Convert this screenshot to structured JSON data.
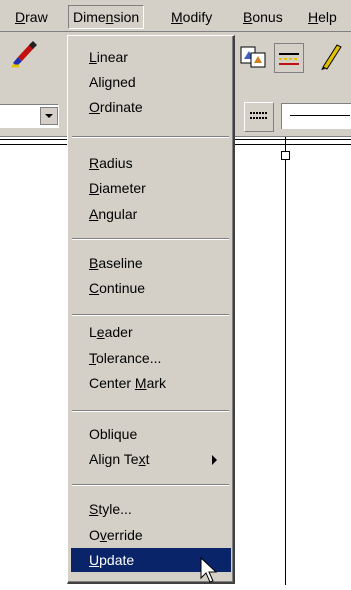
{
  "menubar": {
    "items": [
      {
        "prefix": "",
        "key": "D",
        "suffix": "raw"
      },
      {
        "prefix": "Dime",
        "key": "n",
        "suffix": "sion"
      },
      {
        "prefix": "",
        "key": "M",
        "suffix": "odify"
      },
      {
        "prefix": "",
        "key": "B",
        "suffix": "onus"
      },
      {
        "prefix": "",
        "key": "H",
        "suffix": "elp"
      }
    ]
  },
  "dimension_menu": {
    "items": [
      {
        "prefix": "",
        "key": "L",
        "suffix": "inear"
      },
      {
        "prefix": "Aligned",
        "key": "",
        "suffix": ""
      },
      {
        "prefix": "",
        "key": "O",
        "suffix": "rdinate"
      },
      {
        "prefix": "",
        "key": "R",
        "suffix": "adius"
      },
      {
        "prefix": "",
        "key": "D",
        "suffix": "iameter"
      },
      {
        "prefix": "",
        "key": "A",
        "suffix": "ngular"
      },
      {
        "prefix": "",
        "key": "B",
        "suffix": "aseline"
      },
      {
        "prefix": "",
        "key": "C",
        "suffix": "ontinue"
      },
      {
        "prefix": "L",
        "key": "e",
        "suffix": "ader"
      },
      {
        "prefix": "",
        "key": "T",
        "suffix": "olerance..."
      },
      {
        "prefix": "Center ",
        "key": "M",
        "suffix": "ark"
      },
      {
        "prefix": "Oblique",
        "key": "",
        "suffix": ""
      },
      {
        "prefix": "Align Te",
        "key": "x",
        "suffix": "t"
      },
      {
        "prefix": "",
        "key": "S",
        "suffix": "tyle..."
      },
      {
        "prefix": "O",
        "key": "v",
        "suffix": "erride"
      },
      {
        "prefix": "",
        "key": "U",
        "suffix": "pdate"
      }
    ]
  },
  "colors": {
    "menu_bg": "#d4d0c8",
    "highlight": "#0a246a",
    "highlight_text": "#ffffff"
  }
}
